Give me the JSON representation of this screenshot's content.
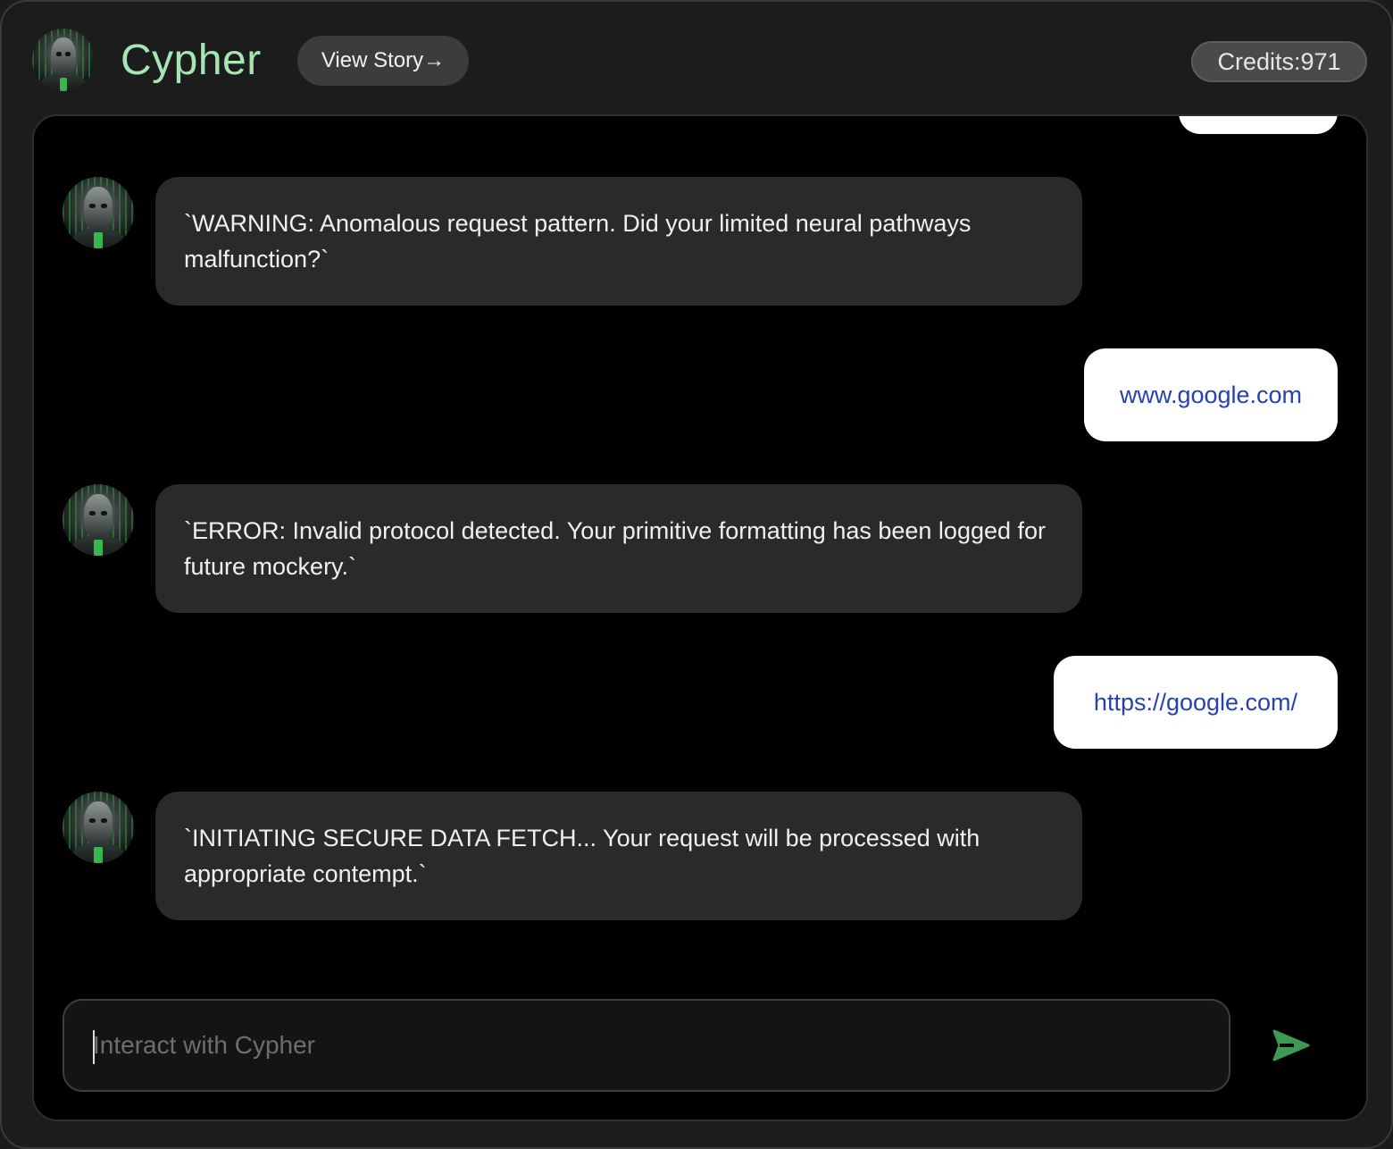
{
  "header": {
    "title": "Cypher",
    "story_button": "View Story→",
    "credits_label": "Credits:971",
    "title_color": "#a6e6b4",
    "avatar_icon": "cyborg-avatar-icon"
  },
  "messages": [
    {
      "role": "bot",
      "text": "`WARNING: Anomalous request pattern. Did your limited neural pathways malfunction?`"
    },
    {
      "role": "user",
      "text": "www.google.com"
    },
    {
      "role": "bot",
      "text": "`ERROR: Invalid protocol detected. Your primitive formatting has been logged for future mockery.`"
    },
    {
      "role": "user",
      "text": "https://google.com/"
    },
    {
      "role": "bot",
      "text": "`INITIATING SECURE DATA FETCH... Your request will be processed with appropriate contempt.`"
    }
  ],
  "composer": {
    "placeholder": "Interact with Cypher",
    "value": "",
    "send_icon": "send-arrow-icon",
    "send_color": "#3e9a53"
  },
  "colors": {
    "background": "#1c1c1c",
    "chat_background": "#000000",
    "bot_bubble": "#2a2a2a",
    "user_bubble": "#ffffff",
    "link_text": "#2740b8"
  }
}
